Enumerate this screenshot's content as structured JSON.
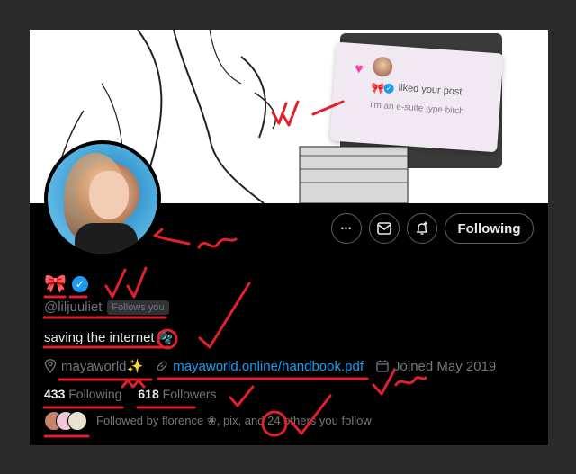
{
  "banner": {
    "notification_text": "liked your post",
    "notification_sub": "i'm an e-suite type bitch"
  },
  "actions": {
    "more_glyph": "•••",
    "message_glyph": "✉",
    "subscribe_glyph": "🔔",
    "following_label": "Following"
  },
  "profile": {
    "ribbon": "🎀",
    "handle": "@liljuuliet",
    "follows_you": "Follows you",
    "bio": "saving the internet",
    "bio_emoji": "🫧",
    "location": "mayaworld✨",
    "website": "mayaworld.online/handbook.pdf",
    "joined": "Joined May 2019"
  },
  "stats": {
    "following_count": "433",
    "following_label": "Following",
    "followers_count": "618",
    "followers_label": "Followers"
  },
  "followed_by": {
    "text": "Followed by florence ❀, pix, and 24 others you follow"
  },
  "colors": {
    "accent": "#1d9bf0",
    "annotation": "#e0202a",
    "muted": "#71767b"
  },
  "icons": [
    "ellipsis-icon",
    "mail-icon",
    "bell-plus-icon",
    "location-icon",
    "link-icon",
    "calendar-icon",
    "verified-icon"
  ]
}
